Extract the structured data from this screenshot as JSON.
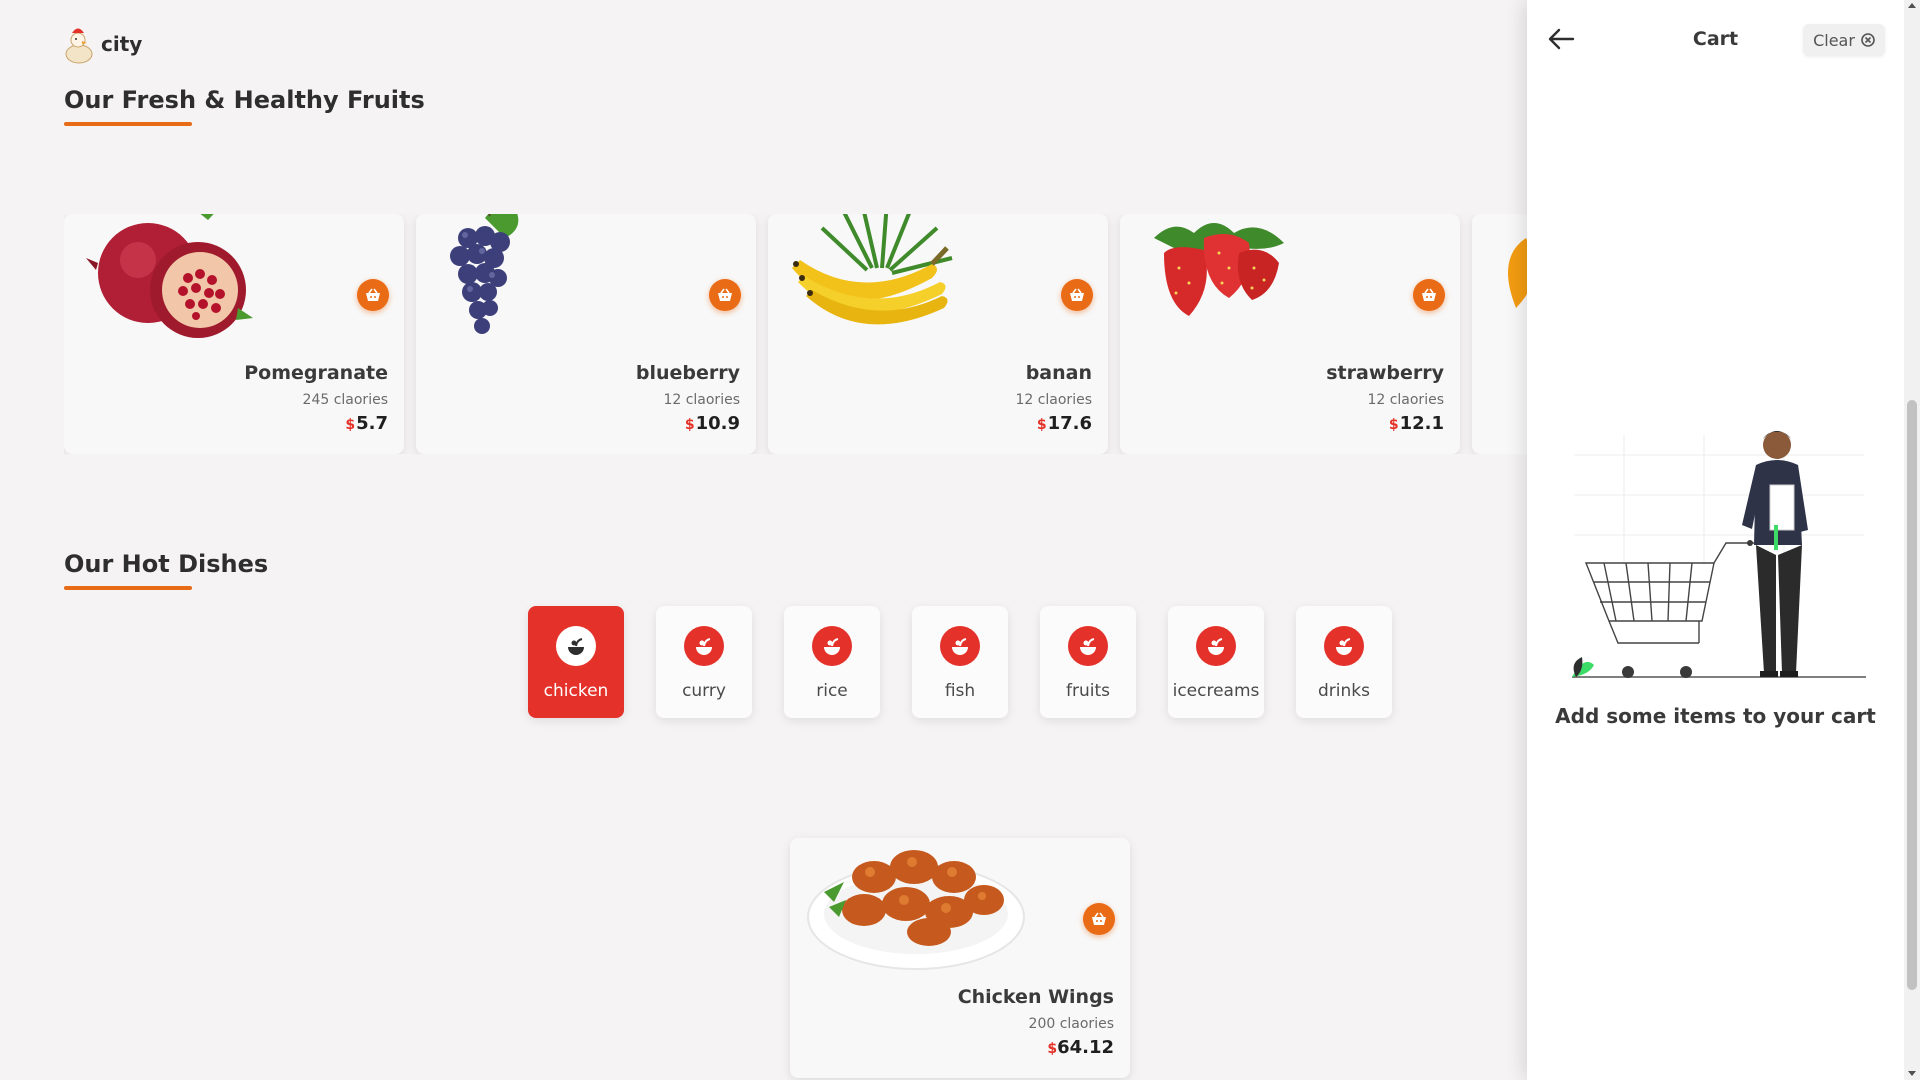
{
  "header": {
    "brand": "city"
  },
  "fruits_section": {
    "title": "Our Fresh & Healthy Fruits",
    "currency_symbol": "$",
    "items": [
      {
        "name": "Pomegranate",
        "calories": "245 claories",
        "price": "5.7"
      },
      {
        "name": "blueberry",
        "calories": "12 claories",
        "price": "10.9"
      },
      {
        "name": "banan",
        "calories": "12 claories",
        "price": "17.6"
      },
      {
        "name": "strawberry",
        "calories": "12 claories",
        "price": "12.1"
      }
    ]
  },
  "dishes_section": {
    "title": "Our Hot Dishes",
    "categories": [
      {
        "label": "chicken",
        "active": true
      },
      {
        "label": "curry",
        "active": false
      },
      {
        "label": "rice",
        "active": false
      },
      {
        "label": "fish",
        "active": false
      },
      {
        "label": "fruits",
        "active": false
      },
      {
        "label": "icecreams",
        "active": false
      },
      {
        "label": "drinks",
        "active": false
      }
    ],
    "items": [
      {
        "name": "Chicken Wings",
        "calories": "200 claories",
        "price": "64.12"
      }
    ]
  },
  "cart": {
    "title": "Cart",
    "clear_label": "Clear",
    "empty_message": "Add some items to your cart"
  },
  "icons": {
    "add_to_cart": "basket-icon",
    "category": "food-category-icon",
    "back": "arrow-left-icon",
    "clear": "clear-circle-icon"
  },
  "colors": {
    "accent_orange": "#e96b16",
    "accent_red": "#e4322a",
    "background": "#f5f3f3"
  }
}
